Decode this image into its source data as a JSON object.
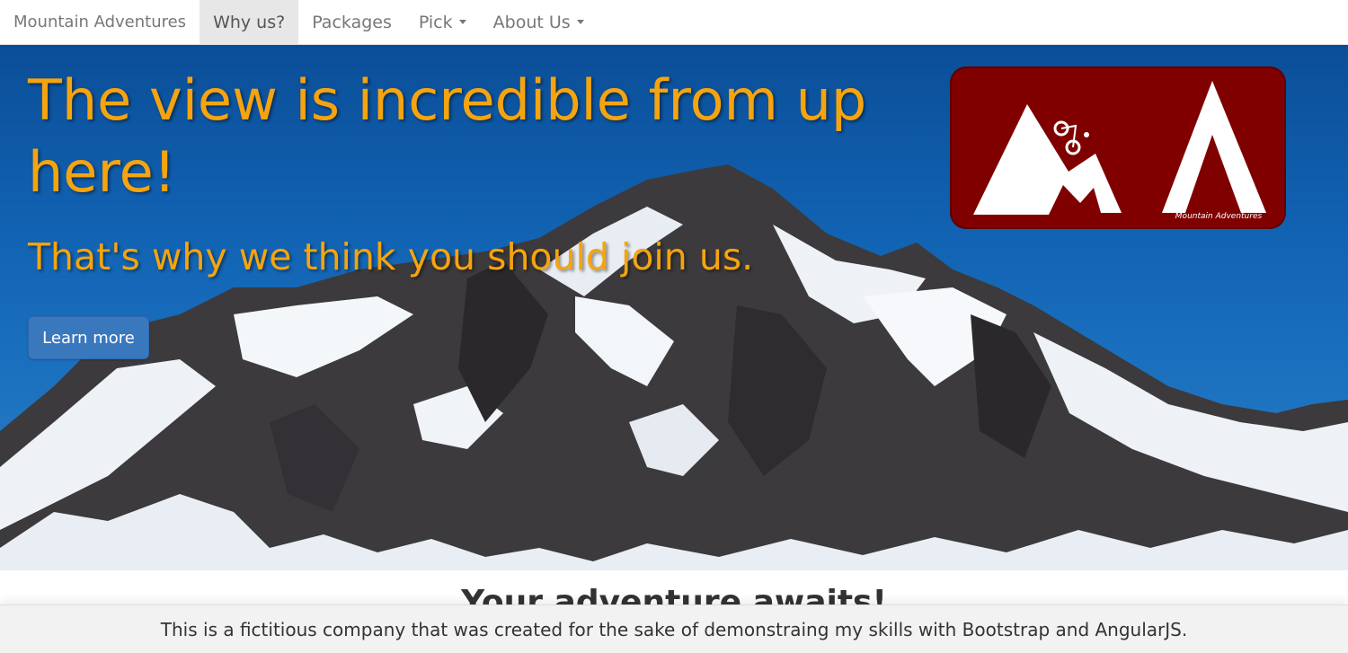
{
  "navbar": {
    "brand": "Mountain Adventures",
    "items": [
      {
        "label": "Why us?",
        "active": true,
        "dropdown": false
      },
      {
        "label": "Packages",
        "active": false,
        "dropdown": false
      },
      {
        "label": "Pick",
        "active": false,
        "dropdown": true
      },
      {
        "label": "About Us",
        "active": false,
        "dropdown": true
      }
    ]
  },
  "hero": {
    "title": "The view is incredible from up here!",
    "subtitle": "That's why we think you should join us.",
    "button_label": "Learn more",
    "logo_text": "Mountain Adventures",
    "colors": {
      "headline": "#f5a40f",
      "logo_background": "#800000",
      "button": "#3a78be"
    }
  },
  "section": {
    "heading": "Your adventure awaits!"
  },
  "footer": {
    "text": "This is a fictitious company that was created for the sake of demonstraing my skills with Bootstrap and AngularJS."
  }
}
